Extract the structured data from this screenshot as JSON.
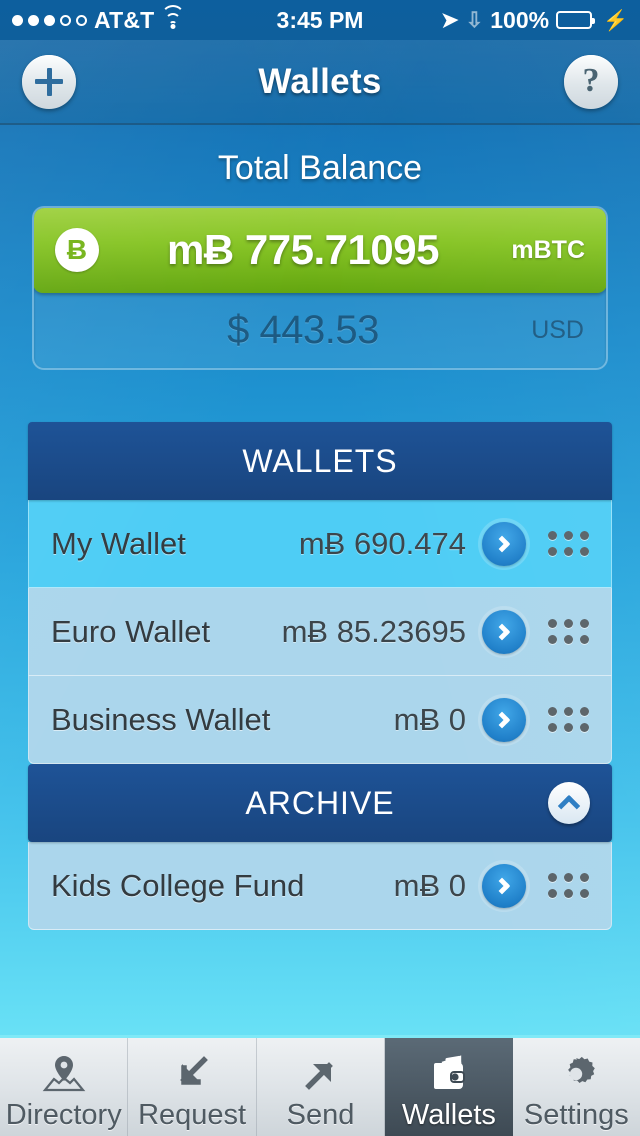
{
  "statusbar": {
    "signal_filled": 3,
    "signal_empty": 2,
    "carrier": "AT&T",
    "wifi_icon": "wifi-icon",
    "time": "3:45 PM",
    "location_icon": "location-arrow-icon",
    "bluetooth_icon": "bluetooth-icon",
    "battery_text": "100%",
    "battery_level": 100,
    "charging_icon": "lightning-bolt-icon"
  },
  "navbar": {
    "title": "Wallets",
    "add_icon": "plus-icon",
    "help_label": "?",
    "help_icon": "question-mark-icon"
  },
  "balance": {
    "title": "Total Balance",
    "btc_symbol": "Ƀ",
    "btc_icon": "bitcoin-coin-icon",
    "btc_amount": "mɃ 775.71095",
    "btc_unit": "mBTC",
    "usd_amount": "$ 443.53",
    "usd_unit": "USD",
    "accent_green": "#86c424"
  },
  "wallets_section": {
    "header": "WALLETS",
    "rows": [
      {
        "name": "My Wallet",
        "amount": "mɃ 690.474",
        "active": true,
        "chevron_icon": "chevron-right-icon",
        "handle_icon": "drag-handle-icon"
      },
      {
        "name": "Euro Wallet",
        "amount": "mɃ 85.23695",
        "active": false,
        "chevron_icon": "chevron-right-icon",
        "handle_icon": "drag-handle-icon"
      },
      {
        "name": "Business Wallet",
        "amount": "mɃ 0",
        "active": false,
        "chevron_icon": "chevron-right-icon",
        "handle_icon": "drag-handle-icon"
      }
    ]
  },
  "archive_section": {
    "header": "ARCHIVE",
    "collapse_icon": "chevron-up-icon",
    "rows": [
      {
        "name": "Kids College Fund",
        "amount": "mɃ 0",
        "active": false,
        "chevron_icon": "chevron-right-icon",
        "handle_icon": "drag-handle-icon"
      }
    ]
  },
  "tabbar": {
    "tabs": [
      {
        "label": "Directory",
        "icon": "map-pin-icon",
        "active": false
      },
      {
        "label": "Request",
        "icon": "arrow-down-left-icon",
        "active": false
      },
      {
        "label": "Send",
        "icon": "arrow-up-right-icon",
        "active": false
      },
      {
        "label": "Wallets",
        "icon": "wallet-icon",
        "active": true
      },
      {
        "label": "Settings",
        "icon": "gear-icon",
        "active": false
      }
    ]
  }
}
